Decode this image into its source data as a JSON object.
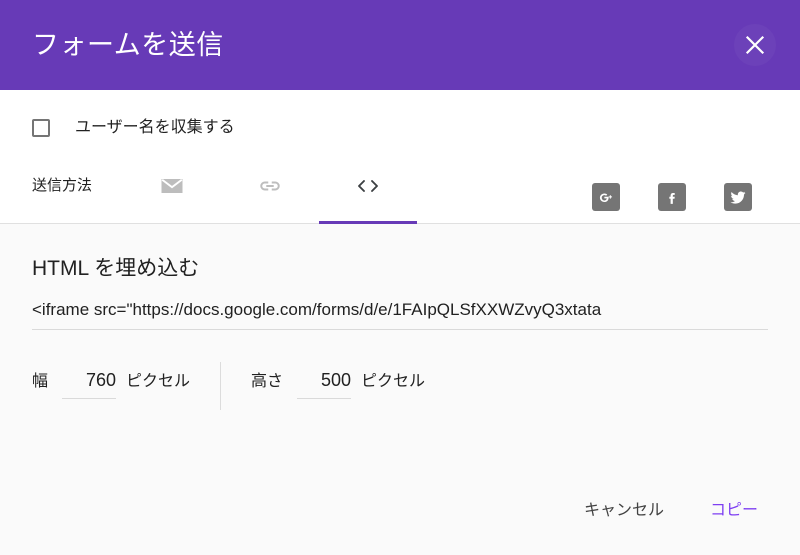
{
  "dialog": {
    "title": "フォームを送信",
    "close_icon": "close-icon",
    "accent_color": "#673ab7",
    "header_bg": "#673ab7",
    "header_text_color": "#ffffff",
    "body_bg": "#fafafa"
  },
  "options": {
    "collect_username": {
      "label": "ユーザー名を収集する",
      "checked": false
    }
  },
  "send_method": {
    "label": "送信方法",
    "tabs": [
      {
        "id": "email",
        "icon": "email-icon",
        "active": false
      },
      {
        "id": "link",
        "icon": "link-icon",
        "active": false
      },
      {
        "id": "embed",
        "icon": "code-icon",
        "active": true
      }
    ],
    "active_tab": "embed",
    "indicator_color": "#673ab7"
  },
  "social": {
    "buttons": [
      {
        "id": "google-plus",
        "icon": "google-plus-icon",
        "color": "#757575"
      },
      {
        "id": "facebook",
        "icon": "facebook-icon",
        "color": "#757575"
      },
      {
        "id": "twitter",
        "icon": "twitter-icon",
        "color": "#757575"
      }
    ]
  },
  "embed": {
    "heading": "HTML を埋め込む",
    "code_value": "<iframe src=\"https://docs.google.com/forms/d/e/1FAIpQLSfXXWZvyQ3xtata",
    "code_placeholder": "",
    "width": {
      "label": "幅",
      "value": "760",
      "unit": "ピクセル"
    },
    "height": {
      "label": "高さ",
      "value": "500",
      "unit": "ピクセル"
    }
  },
  "footer": {
    "cancel_label": "キャンセル",
    "copy_label": "コピー",
    "copy_color": "#7e3ff2"
  }
}
